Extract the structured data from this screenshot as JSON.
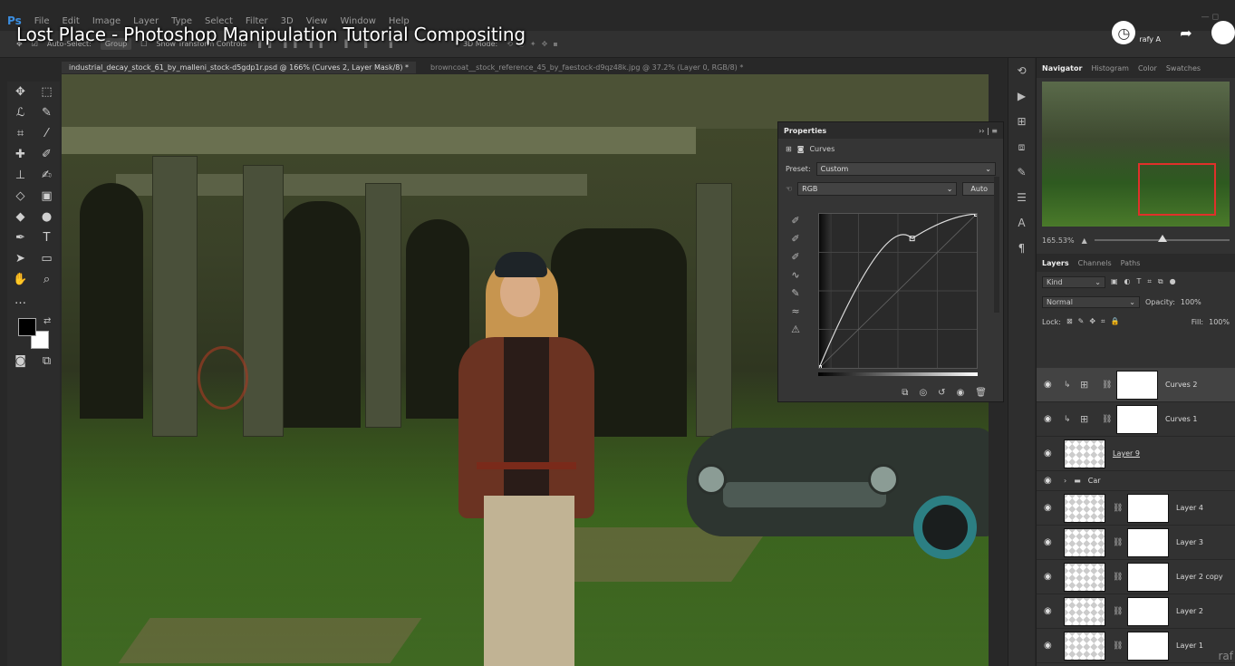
{
  "video": {
    "title": "Lost Place - Photoshop Manipulation Tutorial Compositing",
    "channel_handle": "rafy A",
    "watermark": "raf"
  },
  "menubar": {
    "logo": "Ps",
    "items": [
      "File",
      "Edit",
      "Image",
      "Layer",
      "Type",
      "Select",
      "Filter",
      "3D",
      "View",
      "Window",
      "Help"
    ]
  },
  "options": {
    "auto_select": "Auto-Select:",
    "group": "Group",
    "show_transform": "Show Transform Controls",
    "mode_3d": "3D Mode:"
  },
  "doc_tabs": [
    {
      "label": "industrial_decay_stock_61_by_malleni_stock-d5gdp1r.psd @ 166% (Curves 2, Layer Mask/8) *",
      "active": true
    },
    {
      "label": "browncoat__stock_reference_45_by_faestock-d9qz48k.jpg @ 37.2% (Layer 0, RGB/8) *",
      "active": false
    }
  ],
  "properties": {
    "title": "Properties",
    "panel_type": "Curves",
    "preset_label": "Preset:",
    "preset_value": "Custom",
    "channel_value": "RGB",
    "auto_label": "Auto"
  },
  "curve": {
    "points": [
      [
        0,
        0
      ],
      [
        0.59,
        0.84
      ],
      [
        1,
        1
      ]
    ]
  },
  "right": {
    "nav_tabs": [
      "Navigator",
      "Histogram",
      "Color",
      "Swatches"
    ],
    "zoom": "165.53%",
    "layers_tabs": [
      "Layers",
      "Channels",
      "Paths"
    ],
    "kind_label": "Kind",
    "blend_mode": "Normal",
    "opacity_label": "Opacity:",
    "opacity_value": "100%",
    "lock_label": "Lock:",
    "fill_label": "Fill:",
    "fill_value": "100%"
  },
  "layers": [
    {
      "name": "Curves 2",
      "kind": "adjustment",
      "selected": true
    },
    {
      "name": "Curves 1",
      "kind": "adjustment",
      "selected": false
    },
    {
      "name": "Layer 9",
      "kind": "pixel",
      "selected": false
    },
    {
      "name": "Car",
      "kind": "group",
      "selected": false
    },
    {
      "name": "Layer 4",
      "kind": "masked",
      "selected": false
    },
    {
      "name": "Layer 3",
      "kind": "masked",
      "selected": false
    },
    {
      "name": "Layer 2 copy",
      "kind": "masked",
      "selected": false
    },
    {
      "name": "Layer 2",
      "kind": "masked",
      "selected": false
    },
    {
      "name": "Layer 1",
      "kind": "masked",
      "selected": false
    }
  ],
  "colors": {
    "selection_box": "#e0302a",
    "ps_blue": "#3b8ee0"
  }
}
